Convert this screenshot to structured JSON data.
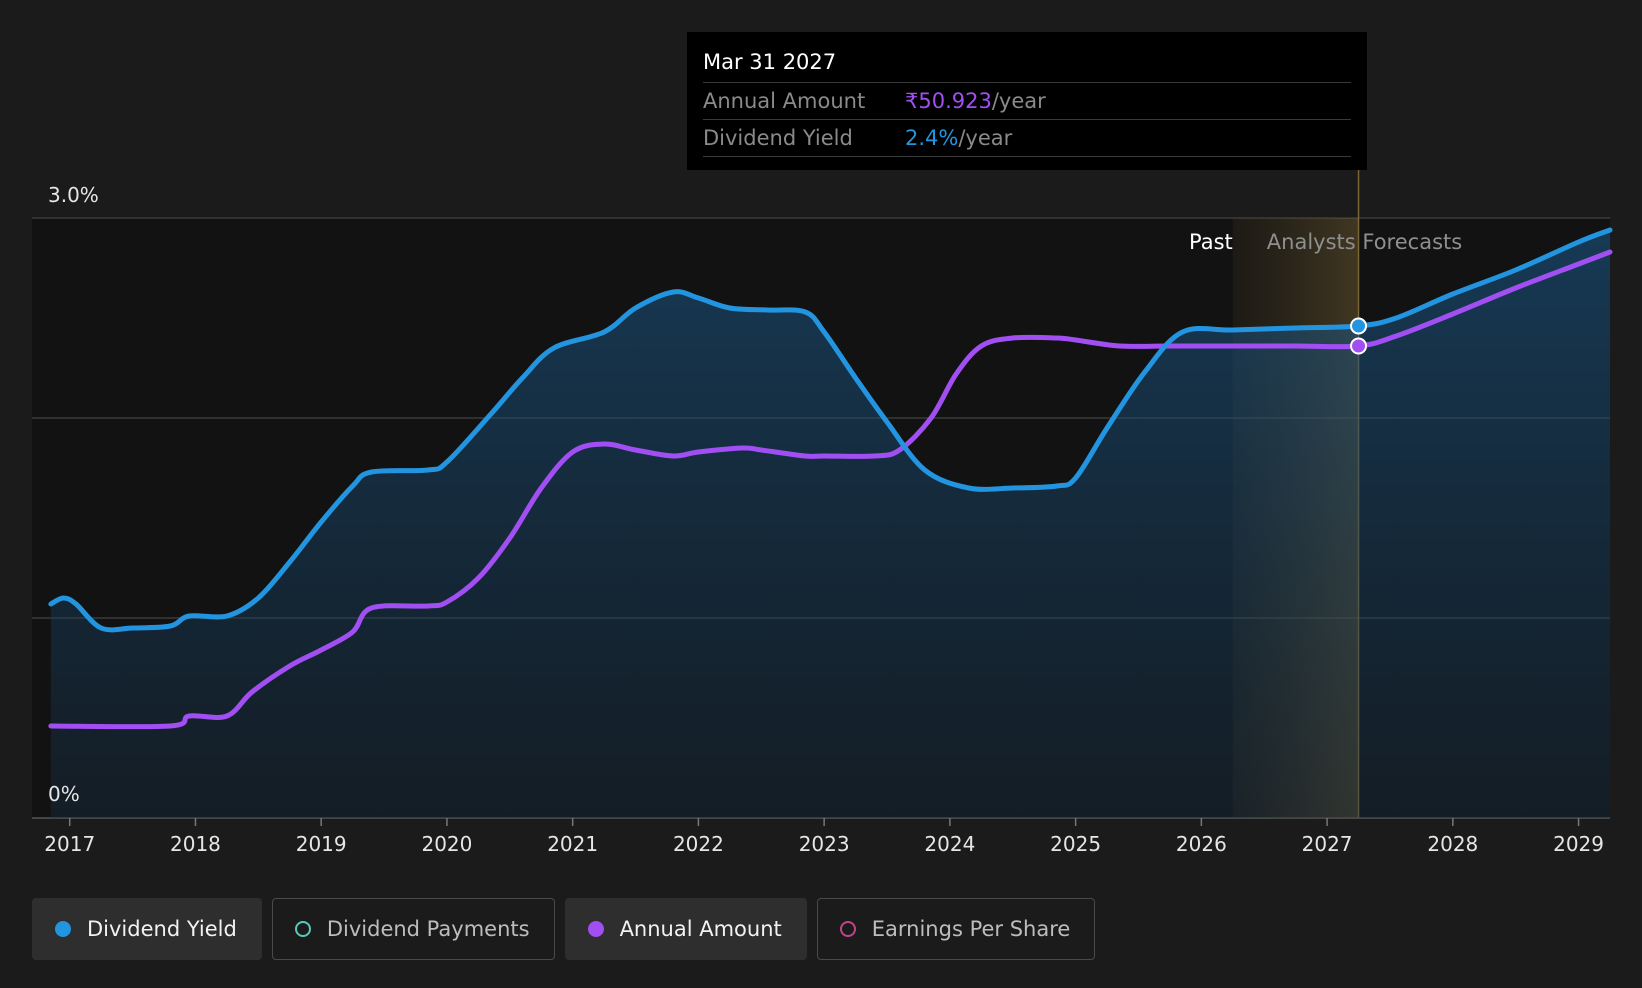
{
  "chart_data": {
    "type": "area",
    "y_top_label": "3.0%",
    "y_bottom_label": "0%",
    "ylim": [
      0,
      3.0
    ],
    "xlim": [
      2016.7,
      2029.25
    ],
    "grid": true,
    "x_ticks": [
      "2017",
      "2018",
      "2019",
      "2020",
      "2021",
      "2022",
      "2023",
      "2024",
      "2025",
      "2026",
      "2027",
      "2028",
      "2029"
    ],
    "past_label": "Past",
    "forecast_label": "Analysts Forecasts",
    "forecast_start": 2026.25,
    "highlight_x": 2027.25,
    "series": [
      {
        "name": "Dividend Yield",
        "color": "#2394df",
        "points": [
          [
            2016.85,
            1.07
          ],
          [
            2016.95,
            1.1
          ],
          [
            2017.05,
            1.07
          ],
          [
            2017.25,
            0.95
          ],
          [
            2017.5,
            0.95
          ],
          [
            2017.8,
            0.96
          ],
          [
            2017.95,
            1.01
          ],
          [
            2018.25,
            1.01
          ],
          [
            2018.5,
            1.1
          ],
          [
            2018.75,
            1.28
          ],
          [
            2019.0,
            1.48
          ],
          [
            2019.25,
            1.66
          ],
          [
            2019.4,
            1.73
          ],
          [
            2019.85,
            1.74
          ],
          [
            2020.0,
            1.78
          ],
          [
            2020.35,
            2.02
          ],
          [
            2020.6,
            2.2
          ],
          [
            2020.85,
            2.35
          ],
          [
            2021.25,
            2.43
          ],
          [
            2021.5,
            2.55
          ],
          [
            2021.8,
            2.63
          ],
          [
            2022.0,
            2.6
          ],
          [
            2022.25,
            2.55
          ],
          [
            2022.55,
            2.54
          ],
          [
            2022.85,
            2.53
          ],
          [
            2023.0,
            2.43
          ],
          [
            2023.25,
            2.2
          ],
          [
            2023.5,
            1.98
          ],
          [
            2023.8,
            1.74
          ],
          [
            2024.15,
            1.65
          ],
          [
            2024.5,
            1.65
          ],
          [
            2024.85,
            1.66
          ],
          [
            2025.0,
            1.7
          ],
          [
            2025.25,
            1.95
          ],
          [
            2025.55,
            2.23
          ],
          [
            2025.85,
            2.43
          ],
          [
            2026.25,
            2.44
          ],
          [
            2026.75,
            2.45
          ],
          [
            2027.25,
            2.46
          ],
          [
            2027.55,
            2.5
          ],
          [
            2028.0,
            2.62
          ],
          [
            2028.5,
            2.74
          ],
          [
            2029.0,
            2.88
          ],
          [
            2029.25,
            2.94
          ]
        ]
      },
      {
        "name": "Annual Amount",
        "color": "#a14ff2",
        "points": [
          [
            2016.85,
            0.46
          ],
          [
            2017.8,
            0.46
          ],
          [
            2017.95,
            0.51
          ],
          [
            2018.25,
            0.51
          ],
          [
            2018.45,
            0.63
          ],
          [
            2018.75,
            0.76
          ],
          [
            2019.0,
            0.84
          ],
          [
            2019.25,
            0.93
          ],
          [
            2019.4,
            1.05
          ],
          [
            2019.85,
            1.06
          ],
          [
            2020.0,
            1.08
          ],
          [
            2020.25,
            1.2
          ],
          [
            2020.5,
            1.4
          ],
          [
            2020.75,
            1.65
          ],
          [
            2021.0,
            1.83
          ],
          [
            2021.25,
            1.87
          ],
          [
            2021.5,
            1.84
          ],
          [
            2021.8,
            1.81
          ],
          [
            2022.0,
            1.83
          ],
          [
            2022.35,
            1.85
          ],
          [
            2022.5,
            1.84
          ],
          [
            2022.85,
            1.81
          ],
          [
            2023.0,
            1.81
          ],
          [
            2023.4,
            1.81
          ],
          [
            2023.6,
            1.84
          ],
          [
            2023.85,
            2.0
          ],
          [
            2024.05,
            2.22
          ],
          [
            2024.25,
            2.36
          ],
          [
            2024.5,
            2.4
          ],
          [
            2024.85,
            2.4
          ],
          [
            2025.0,
            2.39
          ],
          [
            2025.35,
            2.36
          ],
          [
            2025.75,
            2.36
          ],
          [
            2026.25,
            2.36
          ],
          [
            2026.75,
            2.36
          ],
          [
            2027.25,
            2.36
          ],
          [
            2027.55,
            2.41
          ],
          [
            2028.0,
            2.52
          ],
          [
            2028.5,
            2.65
          ],
          [
            2029.0,
            2.77
          ],
          [
            2029.25,
            2.83
          ]
        ]
      }
    ]
  },
  "tooltip": {
    "date": "Mar 31 2027",
    "rows": [
      {
        "label": "Annual Amount",
        "value": "₹50.923",
        "unit": "/year",
        "color": "#a14ff2"
      },
      {
        "label": "Dividend Yield",
        "value": "2.4%",
        "unit": "/year",
        "color": "#2394df"
      }
    ]
  },
  "legend": [
    {
      "label": "Dividend Yield",
      "color": "#2394df",
      "active": true,
      "filled": true
    },
    {
      "label": "Dividend Payments",
      "color": "#59c9b8",
      "active": false,
      "filled": false
    },
    {
      "label": "Annual Amount",
      "color": "#a14ff2",
      "active": true,
      "filled": true
    },
    {
      "label": "Earnings Per Share",
      "color": "#c2458a",
      "active": false,
      "filled": false
    }
  ]
}
